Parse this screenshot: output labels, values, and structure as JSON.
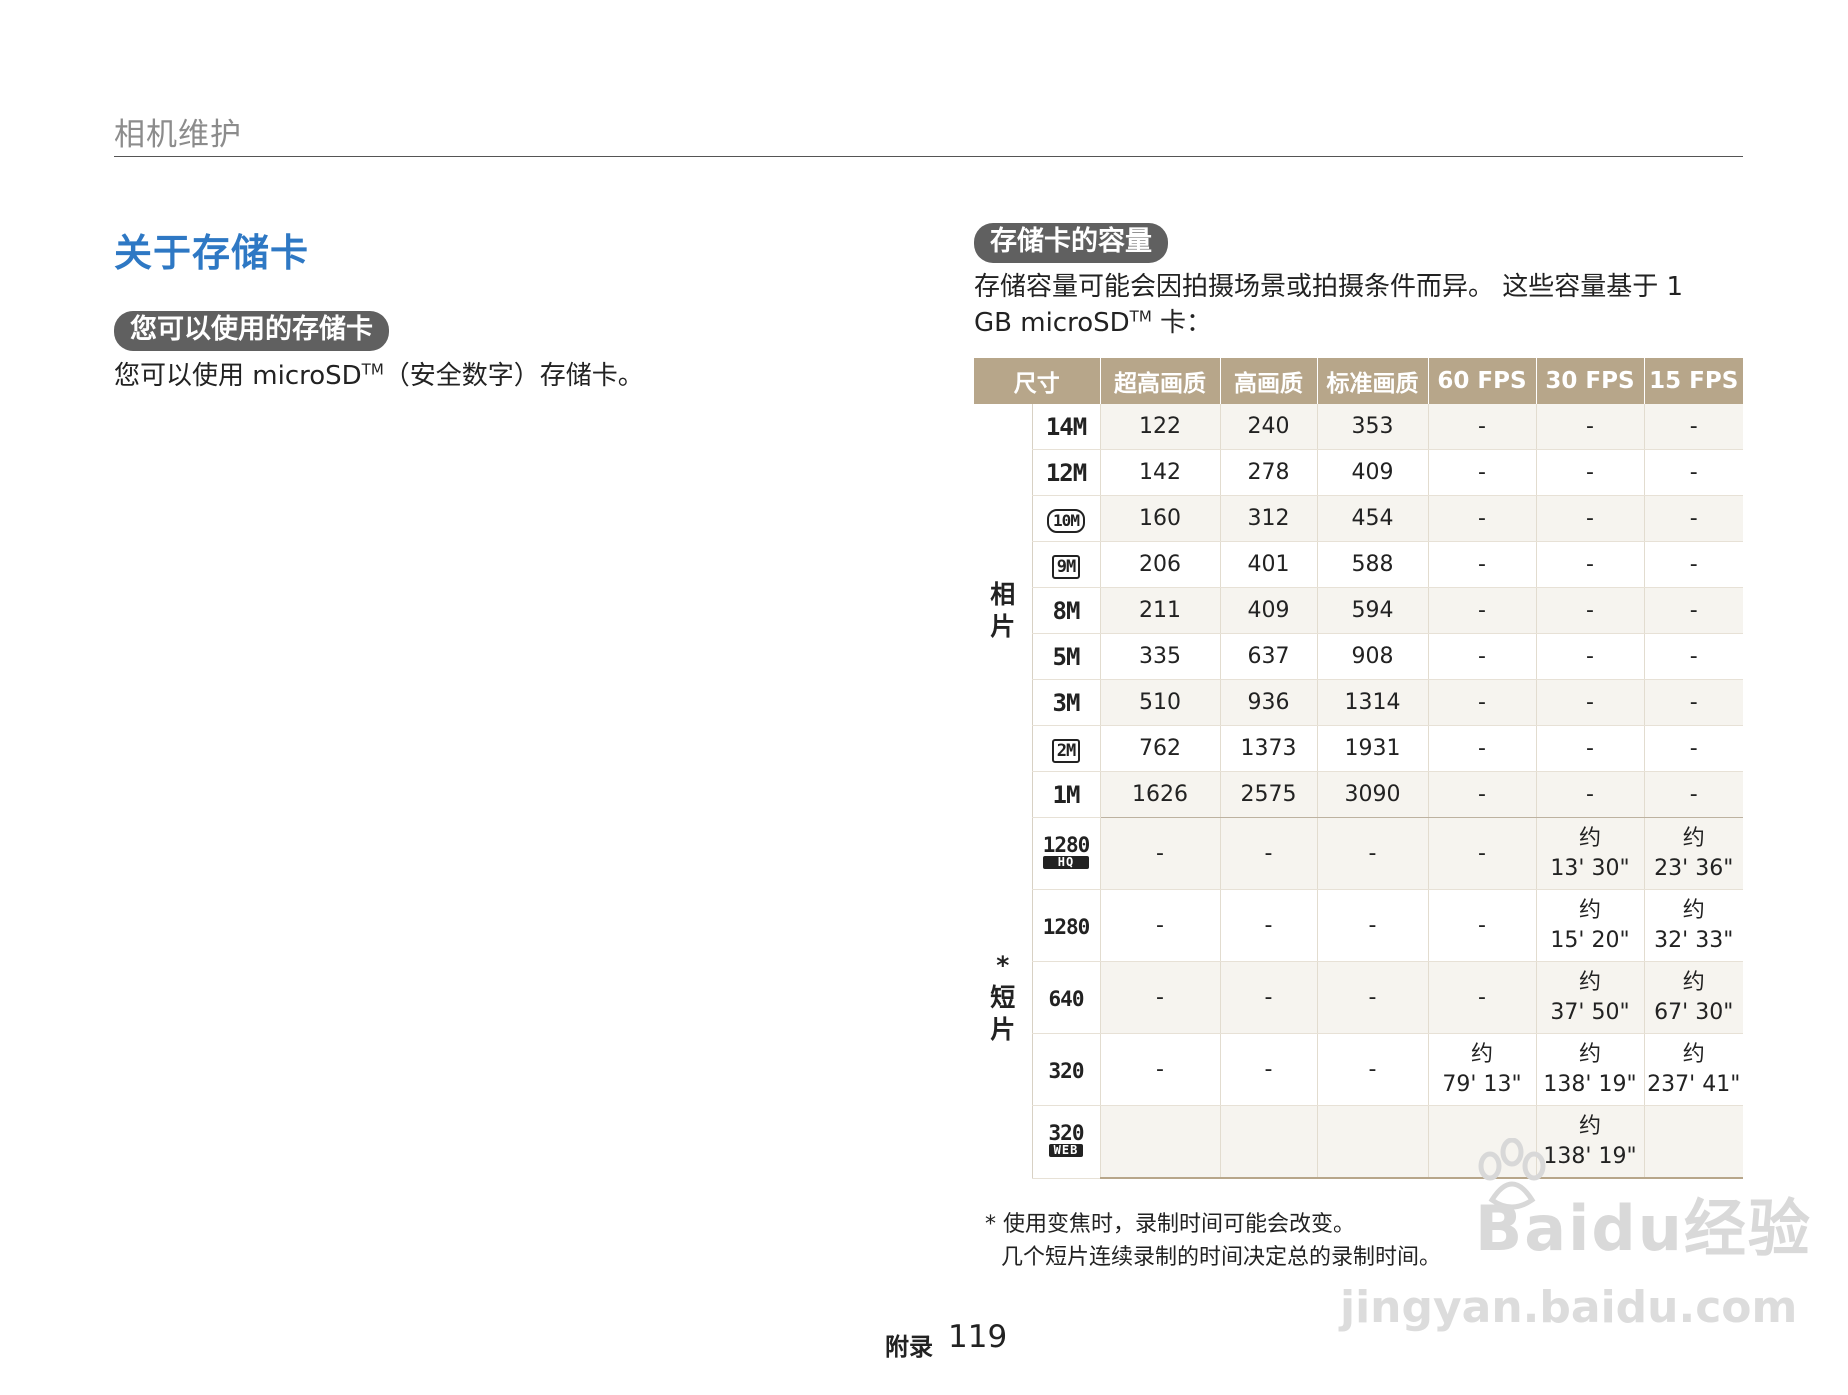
{
  "header": {
    "section_title": "相机维护"
  },
  "page_heading": "关于存储卡",
  "left": {
    "pill": "您可以使用的存储卡",
    "para_before": "您可以使用 microSD",
    "para_tm": "TM",
    "para_after": "（安全数字）存储卡。"
  },
  "right": {
    "pill": "存储卡的容量",
    "para_line1": "存储容量可能会因拍摄场景或拍摄条件而异。 这些容量基于 1",
    "para_line2_before": "GB microSD",
    "para_tm": "TM",
    "para_line2_after": " 卡："
  },
  "table": {
    "headers": [
      "尺寸",
      "超高画质",
      "高画质",
      "标准画质",
      "60 FPS",
      "30 FPS",
      "15 FPS"
    ],
    "photo_group_label": "相片",
    "video_group_label": "* 短片",
    "photo_rows": [
      {
        "icon": "14M",
        "icon_name": "14m-resolution-icon",
        "values": [
          "122",
          "240",
          "353",
          "-",
          "-",
          "-"
        ]
      },
      {
        "icon": "12M",
        "icon_name": "12m-resolution-icon",
        "values": [
          "142",
          "278",
          "409",
          "-",
          "-",
          "-"
        ]
      },
      {
        "icon": "10M",
        "icon_name": "10m-wide-resolution-icon",
        "values": [
          "160",
          "312",
          "454",
          "-",
          "-",
          "-"
        ]
      },
      {
        "icon": "9M",
        "icon_name": "9m-resolution-icon",
        "values": [
          "206",
          "401",
          "588",
          "-",
          "-",
          "-"
        ]
      },
      {
        "icon": "8M",
        "icon_name": "8m-resolution-icon",
        "values": [
          "211",
          "409",
          "594",
          "-",
          "-",
          "-"
        ]
      },
      {
        "icon": "5M",
        "icon_name": "5m-resolution-icon",
        "values": [
          "335",
          "637",
          "908",
          "-",
          "-",
          "-"
        ]
      },
      {
        "icon": "3M",
        "icon_name": "3m-resolution-icon",
        "values": [
          "510",
          "936",
          "1314",
          "-",
          "-",
          "-"
        ]
      },
      {
        "icon": "2M",
        "icon_name": "2m-resolution-icon",
        "values": [
          "762",
          "1373",
          "1931",
          "-",
          "-",
          "-"
        ]
      },
      {
        "icon": "1M",
        "icon_name": "1m-resolution-icon",
        "values": [
          "1626",
          "2575",
          "3090",
          "-",
          "-",
          "-"
        ]
      }
    ],
    "video_rows": [
      {
        "icon": "1280",
        "icon_tag": "HQ",
        "icon_name": "1280-hq-video-icon",
        "values": [
          "-",
          "-",
          "-",
          "-",
          "约\n13' 30\"",
          "约\n23' 36\""
        ]
      },
      {
        "icon": "1280",
        "icon_tag": "",
        "icon_name": "1280-video-icon",
        "values": [
          "-",
          "-",
          "-",
          "-",
          "约\n15' 20\"",
          "约\n32' 33\""
        ]
      },
      {
        "icon": "640",
        "icon_tag": "",
        "icon_name": "640-video-icon",
        "values": [
          "-",
          "-",
          "-",
          "-",
          "约\n37' 50\"",
          "约\n67' 30\""
        ]
      },
      {
        "icon": "320",
        "icon_tag": "",
        "icon_name": "320-video-icon",
        "values": [
          "-",
          "-",
          "-",
          "约\n79' 13\"",
          "约\n138' 19\"",
          "约\n237' 41\""
        ]
      },
      {
        "icon": "320",
        "icon_tag": "WEB",
        "icon_name": "320-web-video-icon",
        "values": [
          "",
          "",
          "",
          "",
          "约\n138' 19\"",
          ""
        ]
      }
    ]
  },
  "footnote": {
    "line1": "* 使用变焦时，录制时间可能会改变。",
    "line2": "  几个短片连续录制的时间决定总的录制时间。"
  },
  "footer": {
    "label": "附录",
    "page_number": "119"
  },
  "watermark": {
    "brand": "Baidu经验",
    "url": "jingyan.baidu.com"
  }
}
